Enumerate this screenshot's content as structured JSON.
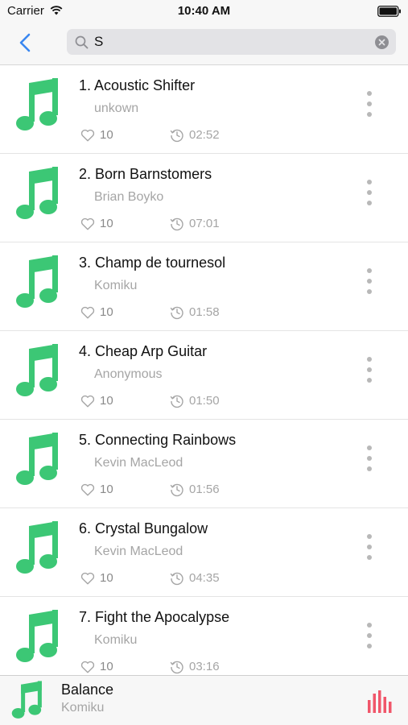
{
  "status_bar": {
    "carrier": "Carrier",
    "time": "10:40 AM"
  },
  "nav": {
    "back_icon": "chevron-left-icon",
    "search": {
      "value": "S",
      "icon": "search-icon",
      "clear_icon": "clear-icon"
    }
  },
  "colors": {
    "accent_blue": "#3a87f0",
    "note_green": "#3cc775",
    "eq_red": "#f0566a"
  },
  "songs": [
    {
      "title": "1. Acoustic Shifter",
      "artist": "unkown",
      "likes": "10",
      "duration": "02:52"
    },
    {
      "title": "2. Born Barnstomers",
      "artist": "Brian Boyko",
      "likes": "10",
      "duration": "07:01"
    },
    {
      "title": "3. Champ de tournesol",
      "artist": "Komiku",
      "likes": "10",
      "duration": "01:58"
    },
    {
      "title": "4. Cheap Arp Guitar",
      "artist": "Anonymous",
      "likes": "10",
      "duration": "01:50"
    },
    {
      "title": "5. Connecting Rainbows",
      "artist": "Kevin MacLeod",
      "likes": "10",
      "duration": "01:56"
    },
    {
      "title": "6. Crystal Bungalow",
      "artist": "Kevin MacLeod",
      "likes": "10",
      "duration": "04:35"
    },
    {
      "title": "7. Fight the Apocalypse",
      "artist": "Komiku",
      "likes": "10",
      "duration": "03:16"
    }
  ],
  "now_playing": {
    "title": "Balance",
    "artist": "Komiku"
  }
}
